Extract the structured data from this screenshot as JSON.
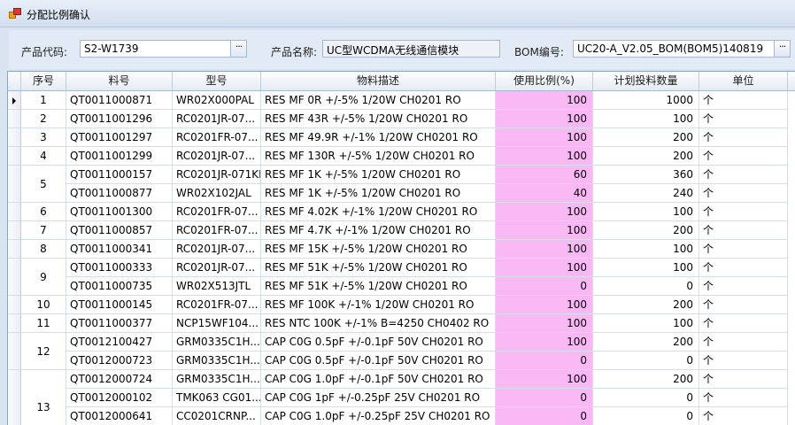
{
  "window": {
    "title": "分配比例确认"
  },
  "form": {
    "product_code_label": "产品代码:",
    "product_code_value": "S2-W1739",
    "product_name_label": "产品名称:",
    "product_name_value": "UC型WCDMA无线通信模块",
    "bom_label": "BOM编号:",
    "bom_value": "UC20-A_V2.05_BOM(BOM5)140819",
    "ellipsis": "···"
  },
  "grid": {
    "columns": [
      "序号",
      "料号",
      "型号",
      "物料描述",
      "使用比例(%)",
      "计划投料数量",
      "单位"
    ],
    "groups": [
      {
        "seq": "1",
        "span": 1
      },
      {
        "seq": "2",
        "span": 1
      },
      {
        "seq": "3",
        "span": 1
      },
      {
        "seq": "4",
        "span": 1
      },
      {
        "seq": "5",
        "span": 2
      },
      {
        "seq": "6",
        "span": 1
      },
      {
        "seq": "7",
        "span": 1
      },
      {
        "seq": "8",
        "span": 1
      },
      {
        "seq": "9",
        "span": 2
      },
      {
        "seq": "10",
        "span": 1
      },
      {
        "seq": "11",
        "span": 1
      },
      {
        "seq": "12",
        "span": 2
      },
      {
        "seq": "13",
        "span": 4
      }
    ],
    "rows": [
      [
        "QT0011000871",
        "WR02X000PAL",
        "RES MF 0R +/-5% 1/20W CH0201 RO",
        "100",
        "1000",
        "个"
      ],
      [
        "QT0011001296",
        "RC0201JR-07...",
        "RES MF 43R +/-5% 1/20W CH0201 RO",
        "100",
        "100",
        "个"
      ],
      [
        "QT0011001297",
        "RC0201FR-07...",
        "RES MF 49.9R +/-1% 1/20W CH0201 RO",
        "100",
        "200",
        "个"
      ],
      [
        "QT0011001299",
        "RC0201JR-07...",
        "RES MF 130R +/-5% 1/20W CH0201 RO",
        "100",
        "200",
        "个"
      ],
      [
        "QT0011000157",
        "RC0201JR-071KL",
        "RES MF 1K +/-5% 1/20W CH0201 RO",
        "60",
        "360",
        "个"
      ],
      [
        "QT0011000877",
        "WR02X102JAL",
        "RES MF 1K +/-5% 1/20W CH0201 RO",
        "40",
        "240",
        "个"
      ],
      [
        "QT0011001300",
        "RC0201FR-07...",
        "RES MF 4.02K +/-1% 1/20W CH0201 RO",
        "100",
        "100",
        "个"
      ],
      [
        "QT0011000857",
        "RC0201FR-07...",
        "RES MF 4.7K +/-1% 1/20W CH0201 RO",
        "100",
        "200",
        "个"
      ],
      [
        "QT0011000341",
        "RC0201JR-07...",
        "RES MF 15K +/-5% 1/20W CH0201 RO",
        "100",
        "100",
        "个"
      ],
      [
        "QT0011000333",
        "RC0201JR-07...",
        "RES MF 51K +/-5% 1/20W CH0201 RO",
        "100",
        "100",
        "个"
      ],
      [
        "QT0011000735",
        "WR02X513JTL",
        "RES MF 51K +/-5% 1/20W CH0201 RO",
        "0",
        "0",
        "个"
      ],
      [
        "QT0011000145",
        "RC0201FR-07...",
        "RES MF 100K +/-1% 1/20W CH0201 RO",
        "100",
        "200",
        "个"
      ],
      [
        "QT0011000377",
        "NCP15WF104...",
        "RES NTC 100K +/-1% B=4250 CH0402 RO",
        "100",
        "100",
        "个"
      ],
      [
        "QT0012100427",
        "GRM0335C1H...",
        "CAP C0G 0.5pF +/-0.1pF 50V CH0201 RO",
        "100",
        "200",
        "个"
      ],
      [
        "QT0012000723",
        "GRM0335C1H...",
        "CAP C0G 0.5pF +/-0.1pF 50V CH0201 RO",
        "0",
        "0",
        "个"
      ],
      [
        "QT0012000724",
        "GRM0335C1H...",
        "CAP C0G 1.0pF +/-0.1pF 50V CH0201 RO",
        "100",
        "200",
        "个"
      ],
      [
        "QT0012000102",
        "TMK063 CG01...",
        "CAP C0G 1pF +/-0.25pF 25V CH0201 RO",
        "0",
        "0",
        "个"
      ],
      [
        "QT0012000641",
        "CC0201CRNP...",
        "CAP C0G 1.0pF +/-0.25pF 25V CH0201 RO",
        "0",
        "0",
        "个"
      ]
    ],
    "ratio_highlight_color": "#f7b8f4"
  }
}
